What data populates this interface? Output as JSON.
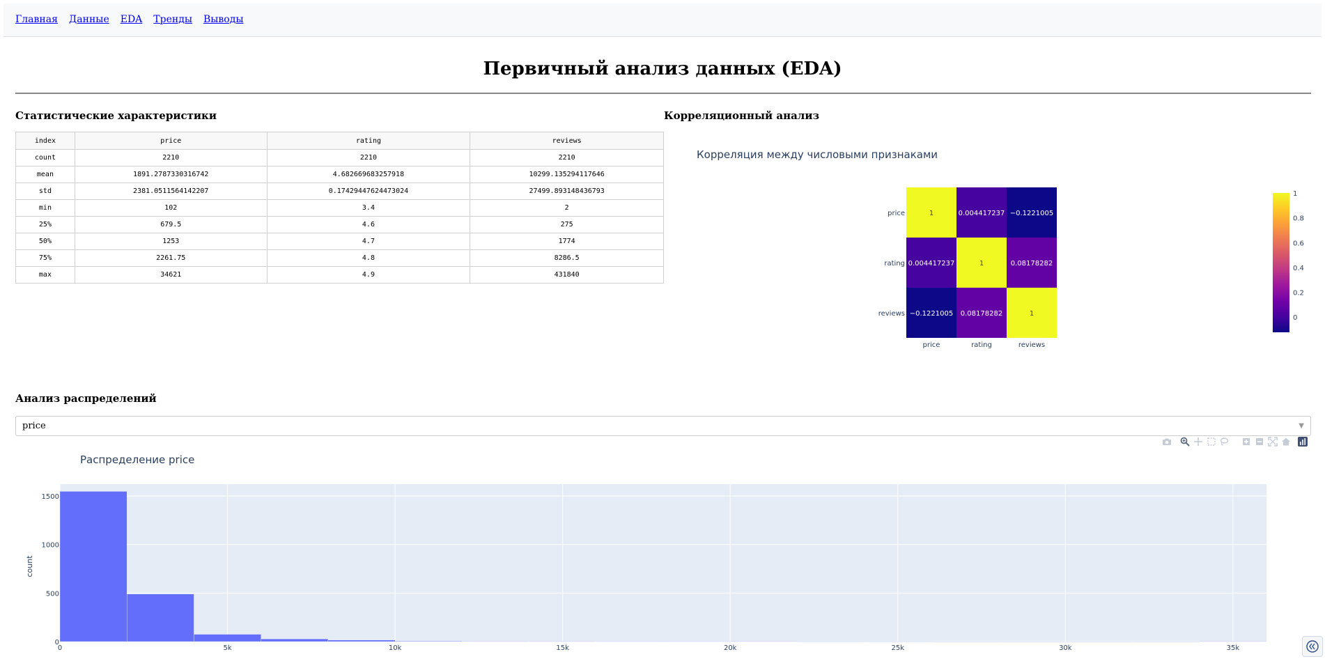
{
  "nav": {
    "links": [
      {
        "label": "Главная"
      },
      {
        "label": "Данные"
      },
      {
        "label": "EDA"
      },
      {
        "label": "Тренды"
      },
      {
        "label": "Выводы"
      }
    ]
  },
  "page_title": "Первичный анализ данных (EDA)",
  "stats": {
    "title": "Статистические характеристики",
    "columns": [
      "index",
      "price",
      "rating",
      "reviews"
    ],
    "rows": [
      [
        "count",
        "2210",
        "2210",
        "2210"
      ],
      [
        "mean",
        "1891.2787330316742",
        "4.682669683257918",
        "10299.135294117646"
      ],
      [
        "std",
        "2381.0511564142207",
        "0.17429447624473024",
        "27499.893148436793"
      ],
      [
        "min",
        "102",
        "3.4",
        "2"
      ],
      [
        "25%",
        "679.5",
        "4.6",
        "275"
      ],
      [
        "50%",
        "1253",
        "4.7",
        "1774"
      ],
      [
        "75%",
        "2261.75",
        "4.8",
        "8286.5"
      ],
      [
        "max",
        "34621",
        "4.9",
        "431840"
      ]
    ]
  },
  "corr_section": {
    "title": "Корреляционный анализ"
  },
  "dist_section": {
    "title": "Анализ распределений"
  },
  "dropdown": {
    "value": "price"
  },
  "colors": {
    "hist_bar": "#636efa",
    "plot_bg": "#e5ecf6",
    "title_color": "#2a3f5f"
  },
  "chart_data": [
    {
      "type": "heatmap",
      "title": "Корреляция между числовыми признаками",
      "x": [
        "price",
        "rating",
        "reviews"
      ],
      "y": [
        "price",
        "rating",
        "reviews"
      ],
      "z": [
        [
          1,
          0.004417237,
          -0.1221005
        ],
        [
          0.004417237,
          1,
          0.08178282
        ],
        [
          -0.1221005,
          0.08178282,
          1
        ]
      ],
      "z_labels": [
        [
          "1",
          "0.004417237",
          "−0.1221005"
        ],
        [
          "0.004417237",
          "1",
          "0.08178282"
        ],
        [
          "−0.1221005",
          "0.08178282",
          "1"
        ]
      ],
      "colorscale": "Plasma",
      "colorbar_ticks": [
        "1",
        "0.8",
        "0.6",
        "0.4",
        "0.2",
        "0"
      ],
      "colorbar_tick_values": [
        1,
        0.8,
        0.6,
        0.4,
        0.2,
        0
      ],
      "zrange": [
        -0.1221005,
        1
      ]
    },
    {
      "type": "bar",
      "title": "Распределение price",
      "xlabel": "",
      "ylabel": "count",
      "bin_width": 5000,
      "bin_starts": [
        0,
        2000,
        4000,
        6000,
        8000,
        10000,
        12000,
        14000,
        16000,
        18000,
        20000,
        22000,
        24000,
        26000,
        28000,
        30000,
        32000,
        34000
      ],
      "values": [
        1547,
        490,
        75,
        27,
        15,
        5,
        3,
        3,
        2,
        2,
        3,
        1,
        1,
        0,
        0,
        0,
        0,
        3
      ],
      "xlim": [
        0,
        36000
      ],
      "ylim": [
        0,
        1550
      ],
      "x_ticks": [
        0,
        5000,
        10000,
        15000,
        20000,
        25000,
        30000,
        35000
      ],
      "x_tick_labels": [
        "0",
        "5k",
        "10k",
        "15k",
        "20k",
        "25k",
        "30k",
        "35k"
      ],
      "y_ticks": [
        0,
        500,
        1000,
        1500
      ],
      "y_tick_labels": [
        "0",
        "500",
        "1000",
        "1500"
      ]
    }
  ]
}
